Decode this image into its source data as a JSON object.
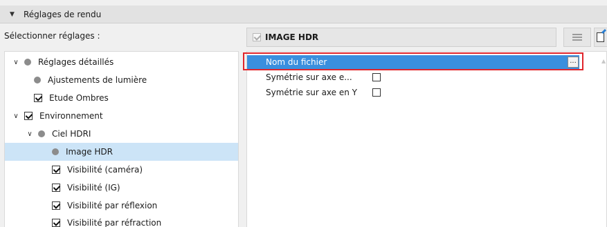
{
  "section": {
    "title": "Réglages de rendu"
  },
  "select_label": "Sélectionner réglages :",
  "tree": [
    {
      "label": "Réglages détaillés",
      "marker": "dot",
      "expanded": true
    },
    {
      "label": "Ajustements de lumière",
      "marker": "dot"
    },
    {
      "label": "Etude Ombres",
      "marker": "checkbox",
      "checked": true
    },
    {
      "label": "Environnement",
      "marker": "checkbox",
      "checked": true,
      "expanded": true
    },
    {
      "label": "Ciel HDRI",
      "marker": "dot",
      "expanded": true
    },
    {
      "label": "Image HDR",
      "marker": "dot",
      "selected": true
    },
    {
      "label": "Visibilité (caméra)",
      "marker": "checkbox",
      "checked": true
    },
    {
      "label": "Visibilité (IG)",
      "marker": "checkbox",
      "checked": true
    },
    {
      "label": "Visibilité par réflexion",
      "marker": "checkbox",
      "checked": true
    },
    {
      "label": "Visibilité par réfraction",
      "marker": "checkbox",
      "checked": true
    }
  ],
  "right_header": {
    "title": "IMAGE HDR"
  },
  "properties": [
    {
      "label": "Nom du fichier",
      "selected": true,
      "browse_label": "..."
    },
    {
      "label": "Symétrie sur axe e...",
      "checked": false
    },
    {
      "label": "Symétrie sur axe en Y",
      "checked": false
    }
  ],
  "colors": {
    "selection_blue": "#3a8fde",
    "tree_selection": "#cce4f7",
    "highlight_red": "#e0252b"
  }
}
